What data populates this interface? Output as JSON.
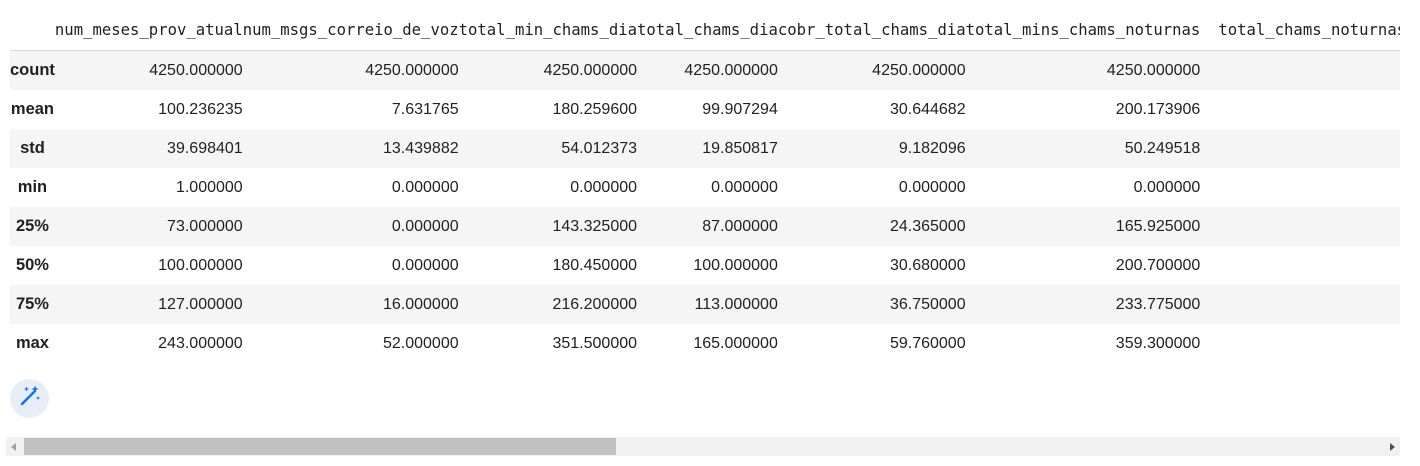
{
  "table": {
    "columns": [
      "",
      "num_meses_prov_atual",
      "num_msgs_correio_de_voz",
      "total_min_chams_dia",
      "total_chams_dia",
      "cobr_total_chams_dia",
      "total_mins_chams_noturnas",
      "total_chams_noturnas"
    ],
    "rows": [
      {
        "label": "count",
        "values": [
          "4250.000000",
          "4250.000000",
          "4250.000000",
          "4250.000000",
          "4250.000000",
          "4250.000000",
          ""
        ]
      },
      {
        "label": "mean",
        "values": [
          "100.236235",
          "7.631765",
          "180.259600",
          "99.907294",
          "30.644682",
          "200.173906",
          ""
        ]
      },
      {
        "label": "std",
        "values": [
          "39.698401",
          "13.439882",
          "54.012373",
          "19.850817",
          "9.182096",
          "50.249518",
          ""
        ]
      },
      {
        "label": "min",
        "values": [
          "1.000000",
          "0.000000",
          "0.000000",
          "0.000000",
          "0.000000",
          "0.000000",
          ""
        ]
      },
      {
        "label": "25%",
        "values": [
          "73.000000",
          "0.000000",
          "143.325000",
          "87.000000",
          "24.365000",
          "165.925000",
          ""
        ]
      },
      {
        "label": "50%",
        "values": [
          "100.000000",
          "0.000000",
          "180.450000",
          "100.000000",
          "30.680000",
          "200.700000",
          ""
        ]
      },
      {
        "label": "75%",
        "values": [
          "127.000000",
          "16.000000",
          "216.200000",
          "113.000000",
          "36.750000",
          "233.775000",
          ""
        ]
      },
      {
        "label": "max",
        "values": [
          "243.000000",
          "52.000000",
          "351.500000",
          "165.000000",
          "59.760000",
          "359.300000",
          ""
        ]
      }
    ]
  },
  "icons": {
    "magic": "magic-wand-sparkle-icon",
    "scroll_left": "triangle-left-icon",
    "scroll_right": "triangle-right-icon"
  },
  "colors": {
    "row_stripe": "#f5f5f5",
    "magic_button_bg": "#e8eef8",
    "magic_icon": "#1a73e8",
    "scroll_track": "#f1f1f1",
    "scroll_thumb": "#c1c1c1"
  }
}
